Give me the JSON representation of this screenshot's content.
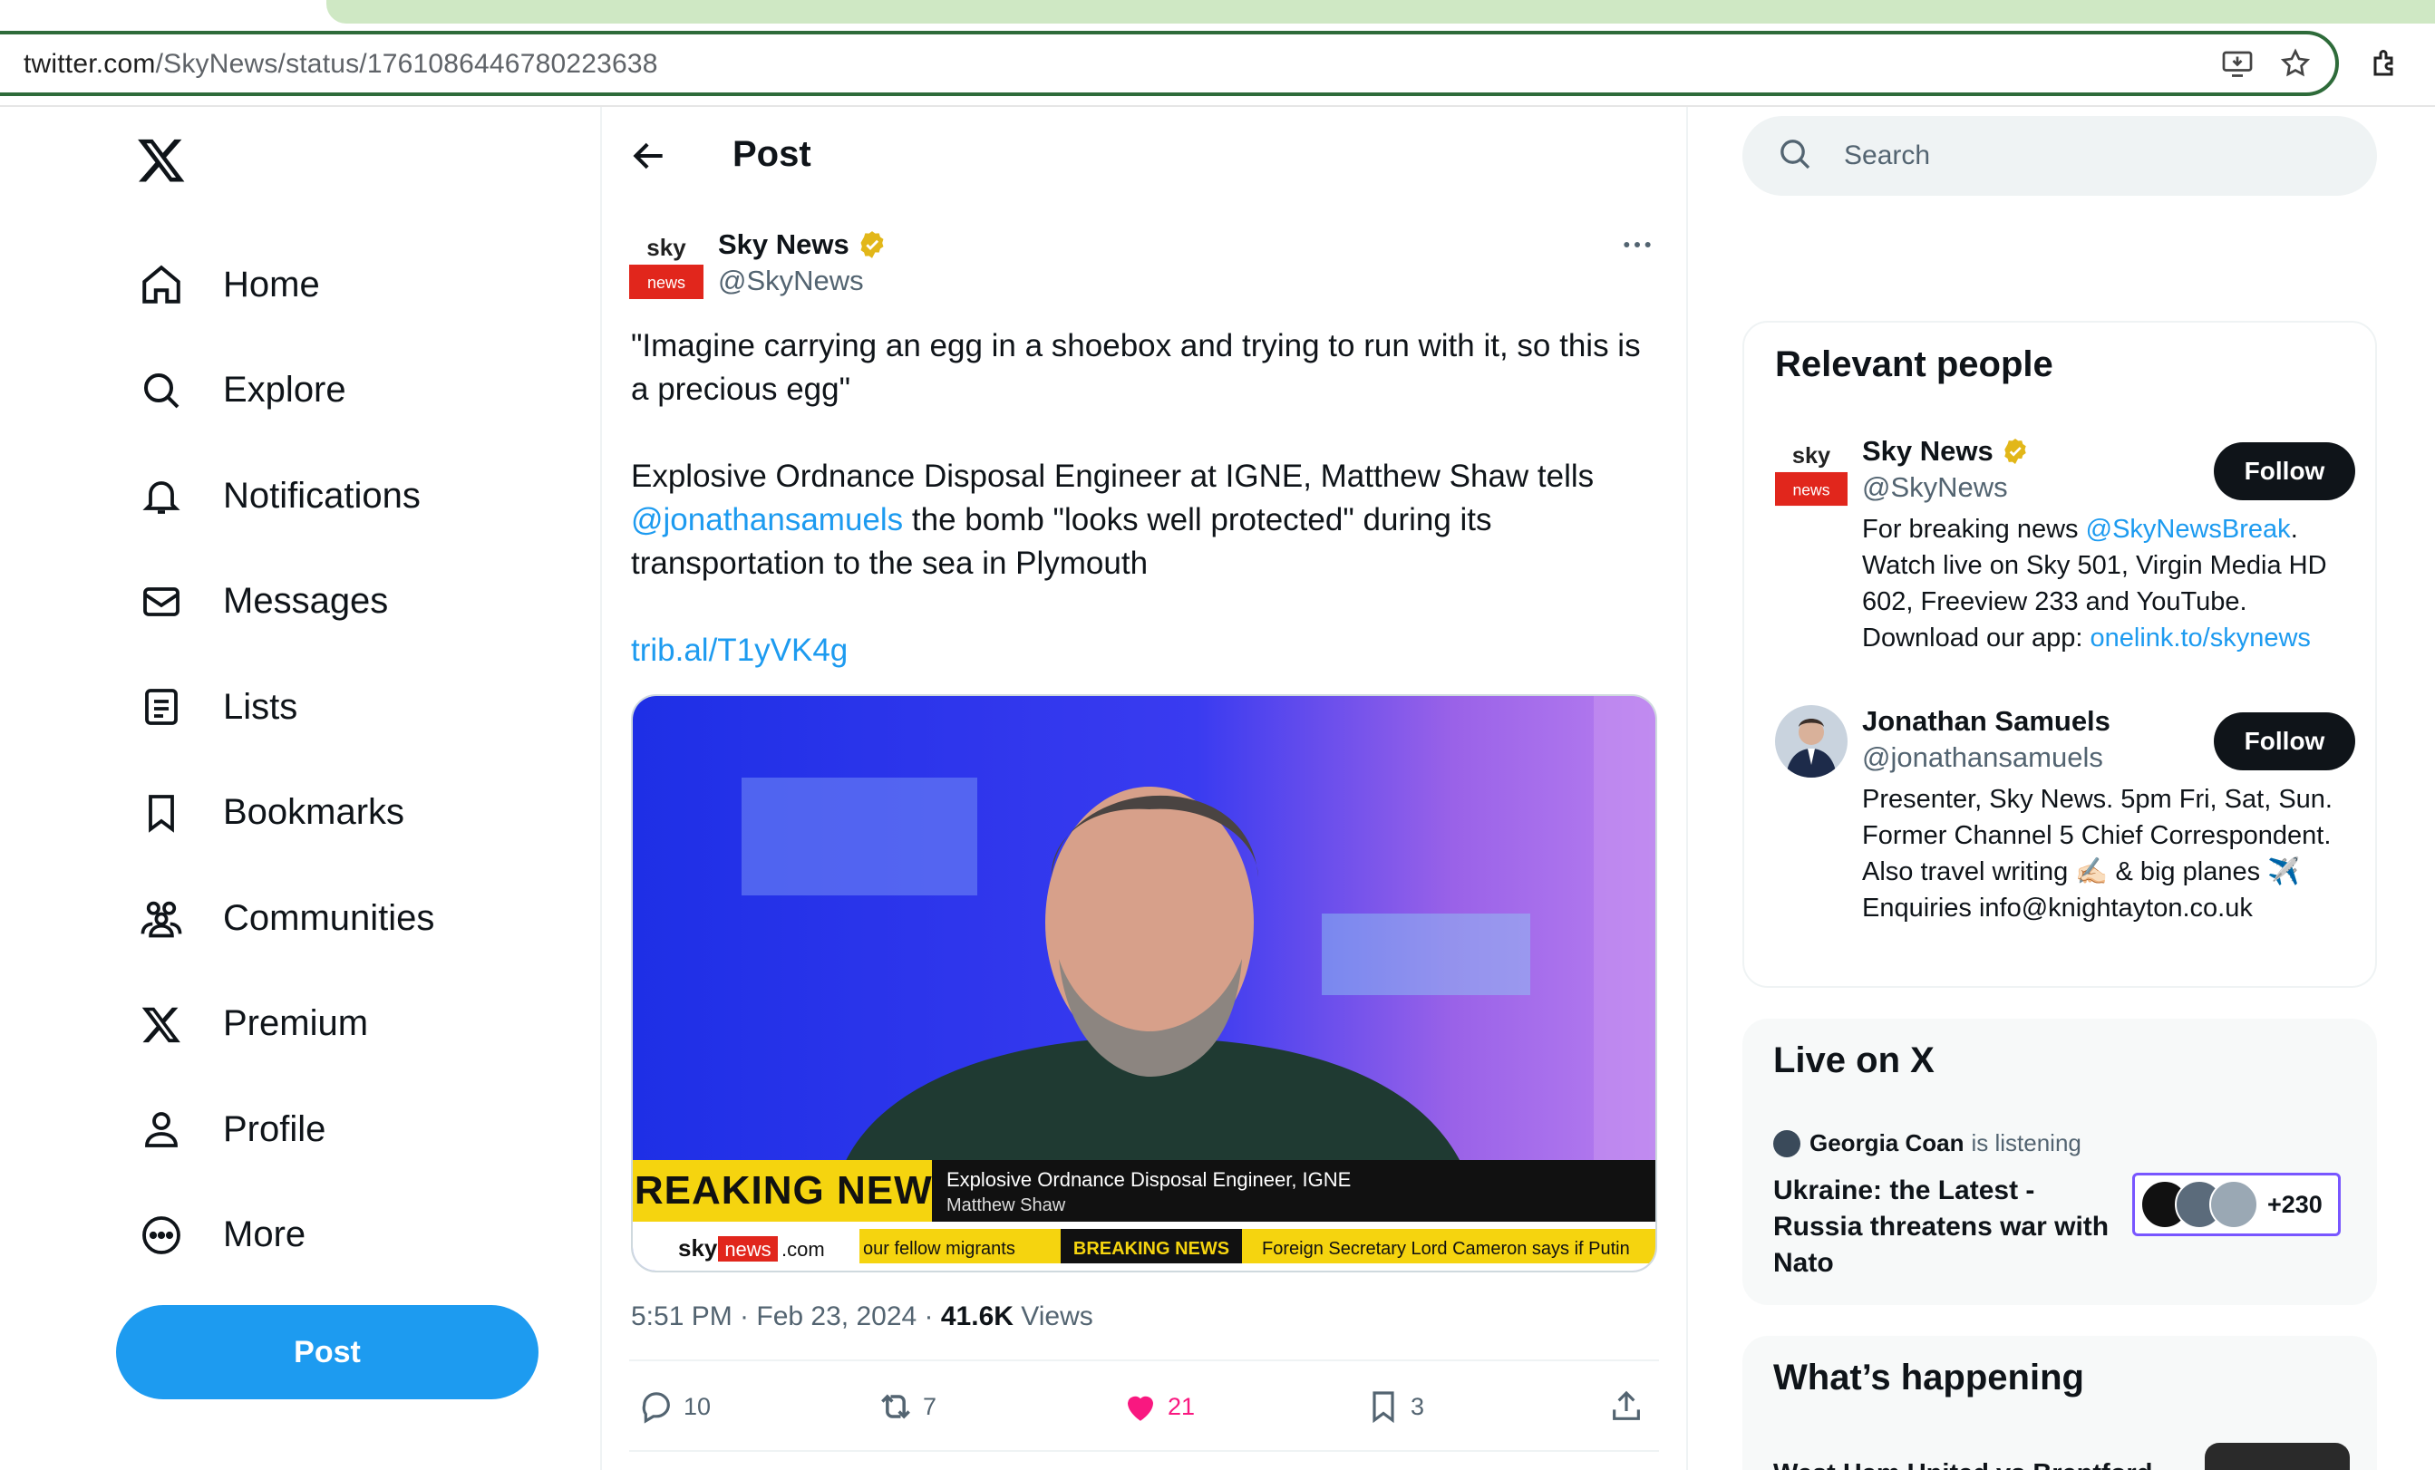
{
  "browser": {
    "url_host": "twitter.com",
    "url_path": "/SkyNews/status/1761086446780223638"
  },
  "nav": {
    "items": [
      {
        "label": "Home",
        "icon": "home-icon"
      },
      {
        "label": "Explore",
        "icon": "search-icon"
      },
      {
        "label": "Notifications",
        "icon": "bell-icon"
      },
      {
        "label": "Messages",
        "icon": "envelope-icon"
      },
      {
        "label": "Lists",
        "icon": "list-icon"
      },
      {
        "label": "Bookmarks",
        "icon": "bookmark-icon"
      },
      {
        "label": "Communities",
        "icon": "people-icon"
      },
      {
        "label": "Premium",
        "icon": "x-logo-icon"
      },
      {
        "label": "Profile",
        "icon": "person-icon"
      },
      {
        "label": "More",
        "icon": "more-circle-icon"
      }
    ],
    "post_button": "Post"
  },
  "header": {
    "title": "Post"
  },
  "tweet": {
    "author_name": "Sky News",
    "author_handle": "@SkyNews",
    "avatar_text_top": "sky",
    "avatar_text_bottom": "news",
    "text_line1": "\"Imagine carrying an egg in a shoebox and trying to run with it, so this is a precious egg\"",
    "text_line2_pre": "Explosive Ordnance Disposal Engineer at IGNE, Matthew Shaw tells ",
    "text_line2_mention": "@jonathansamuels",
    "text_line2_post": " the bomb \"looks well protected\" during its transportation to the sea in Plymouth",
    "link": "trib.al/T1yVK4g",
    "media": {
      "breaking": "BREAKING NEWS",
      "caption_title": "Explosive Ordnance Disposal Engineer, IGNE",
      "caption_name": "Matthew Shaw",
      "brand_sky": "sky",
      "brand_news": "news",
      "brand_com": ".com",
      "ticker_1": "our fellow migrants",
      "ticker_2": "BREAKING NEWS",
      "ticker_3": "Foreign Secretary Lord Cameron says if Putin"
    },
    "time": "5:51 PM · Feb 23, 2024 · ",
    "views_count": "41.6K",
    "views_label": " Views",
    "replies": "10",
    "reposts": "7",
    "likes": "21",
    "bookmarks": "3",
    "colors": {
      "like": "#f91880",
      "link": "#1d9bf0"
    }
  },
  "search": {
    "placeholder": "Search"
  },
  "relevant": {
    "title": "Relevant people",
    "people": [
      {
        "name": "Sky News",
        "handle": "@SkyNews",
        "bio_pre": "For breaking news ",
        "bio_link1": "@SkyNewsBreak",
        "bio_mid": ". Watch live on Sky 501, Virgin Media HD 602, Freeview 233 and YouTube. Download our app: ",
        "bio_link2": "onelink.to/skynews",
        "follow": "Follow"
      },
      {
        "name": "Jonathan Samuels",
        "handle": "@jonathansamuels",
        "bio": "Presenter, Sky News. 5pm Fri, Sat, Sun. Former Channel 5 Chief Correspondent. Also travel writing ✍🏻 & big planes ✈️ Enquiries info@knightayton.co.uk",
        "follow": "Follow"
      }
    ]
  },
  "live": {
    "title": "Live on X",
    "host": "Georgia Coan",
    "status": "is listening",
    "space_title": "Ukraine: the Latest - Russia threatens war with Nato",
    "listeners": "+230"
  },
  "happening": {
    "title": "What’s happening",
    "first_item": "West Ham United vs Brentford"
  }
}
